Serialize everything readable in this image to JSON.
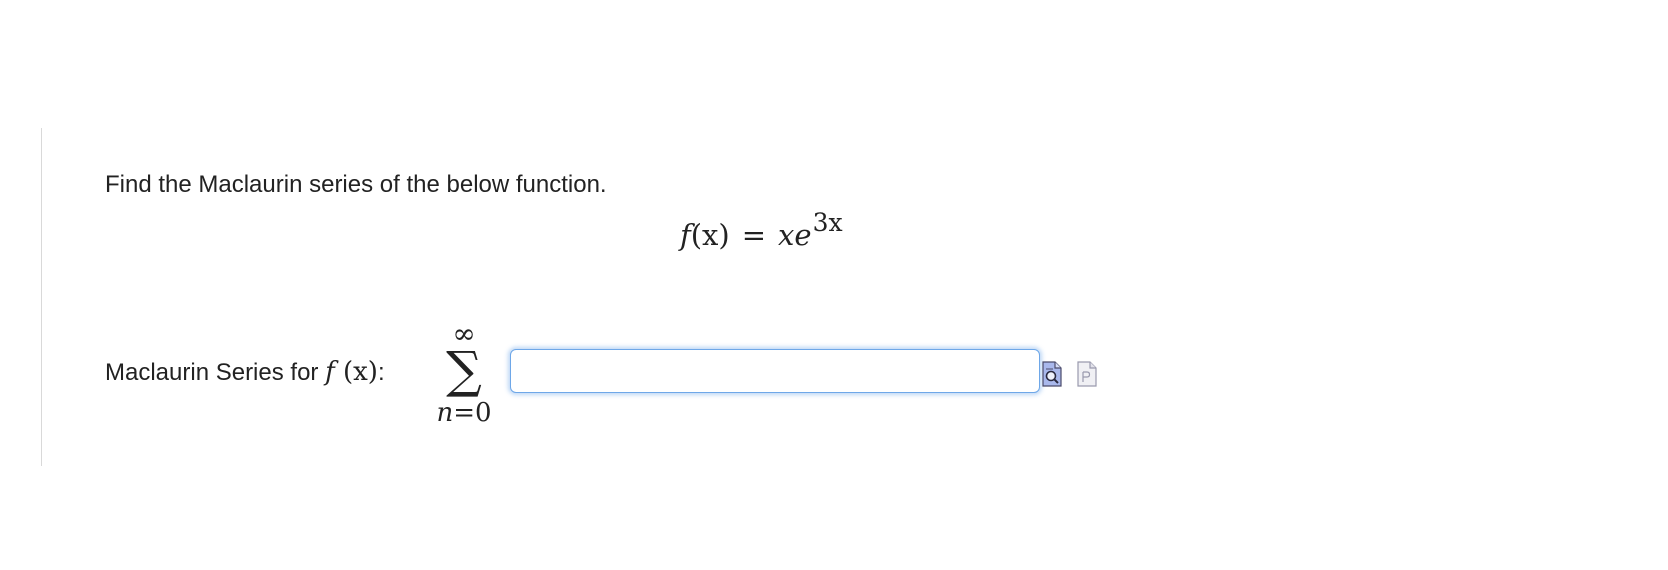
{
  "question": {
    "prompt": "Find the Maclaurin series of the below function.",
    "function": {
      "lhs_name": "f",
      "lhs_arg": "(x)",
      "equals": "=",
      "rhs_base": "xe",
      "rhs_exponent": "3x"
    }
  },
  "answer": {
    "label_text": "Maclaurin Series for",
    "label_function": "f",
    "label_arg": "(x)",
    "label_colon": ":",
    "sum_upper": "∞",
    "sum_symbol": "∑",
    "sum_index": "n",
    "sum_start": "=0",
    "input_value": "",
    "input_placeholder": ""
  },
  "tools": {
    "preview_icon": "preview-magnifier-icon",
    "equation_editor_icon": "equation-editor-icon",
    "accent_color": "#6ea7e8"
  }
}
